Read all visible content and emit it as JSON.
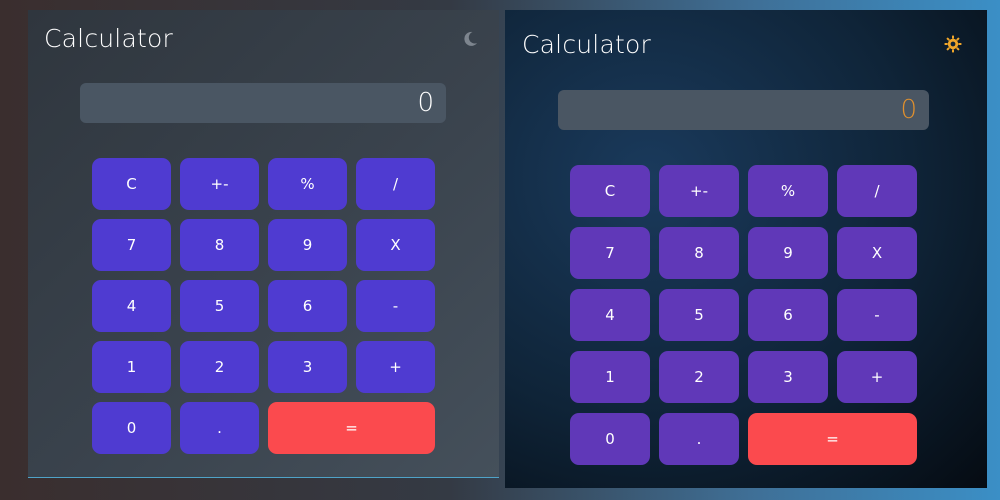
{
  "light": {
    "title": "Calculator",
    "theme_icon": "moon-icon",
    "display_value": "0",
    "keys": {
      "clear": "C",
      "sign": "+-",
      "percent": "%",
      "divide": "/",
      "seven": "7",
      "eight": "8",
      "nine": "9",
      "multiply": "X",
      "four": "4",
      "five": "5",
      "six": "6",
      "subtract": "-",
      "one": "1",
      "two": "2",
      "three": "3",
      "add": "+",
      "zero": "0",
      "decimal": ".",
      "equals": "="
    }
  },
  "dark": {
    "title": "Calculator",
    "theme_icon": "sun-icon",
    "display_value": "0",
    "keys": {
      "clear": "C",
      "sign": "+-",
      "percent": "%",
      "divide": "/",
      "seven": "7",
      "eight": "8",
      "nine": "9",
      "multiply": "X",
      "four": "4",
      "five": "5",
      "six": "6",
      "subtract": "-",
      "one": "1",
      "two": "2",
      "three": "3",
      "add": "+",
      "zero": "0",
      "decimal": ".",
      "equals": "="
    }
  },
  "colors": {
    "light_key": "#4f3bd1",
    "dark_key": "#6038b8",
    "equals_key": "#fb4a4e",
    "dark_display_text": "#e0902e",
    "sun_icon": "#f0a62a"
  }
}
